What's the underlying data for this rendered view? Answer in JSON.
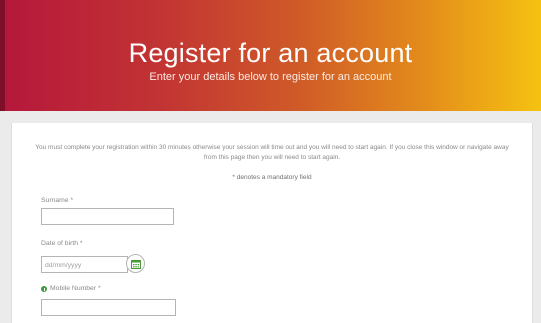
{
  "hero": {
    "title": "Register for an account",
    "subtitle": "Enter your details below to register for an account"
  },
  "form": {
    "notice": "You must complete your registration within 30 minutes otherwise your session will time out and you will need to start again. If you close this window or navigate away from this page then you will need to start again.",
    "mandatory_note": "* denotes a mandatory field",
    "surname": {
      "label": "Surname *",
      "value": ""
    },
    "dob": {
      "label": "Date of birth *",
      "placeholder": "dd/mm/yyyy"
    },
    "mobile": {
      "label": "Mobile Number *",
      "value": ""
    }
  },
  "colors": {
    "gradient_start": "#b5173b",
    "gradient_end": "#f5c211",
    "info_icon": "#3d9a3d"
  },
  "icons": {
    "calendar": "calendar-icon",
    "info": "info-icon"
  }
}
